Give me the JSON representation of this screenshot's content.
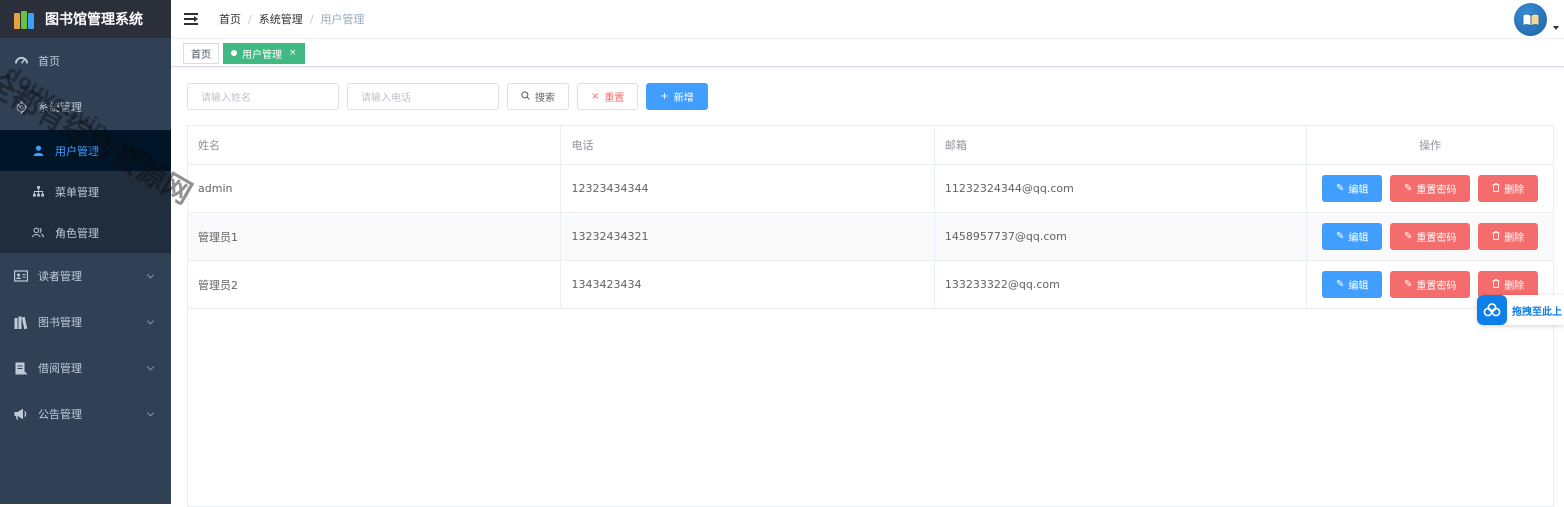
{
  "app": {
    "title": "图书馆管理系统"
  },
  "sidebar": {
    "items": [
      {
        "label": "首页",
        "icon": "dashboard-icon"
      },
      {
        "label": "系统管理",
        "icon": "gear-icon",
        "children": [
          {
            "label": "用户管理",
            "icon": "user-icon",
            "active": true
          },
          {
            "label": "菜单管理",
            "icon": "tree-icon"
          },
          {
            "label": "角色管理",
            "icon": "people-icon"
          }
        ]
      },
      {
        "label": "读者管理",
        "icon": "id-card-icon"
      },
      {
        "label": "图书管理",
        "icon": "books-icon"
      },
      {
        "label": "借阅管理",
        "icon": "document-icon"
      },
      {
        "label": "公告管理",
        "icon": "megaphone-icon"
      }
    ]
  },
  "breadcrumb": [
    "首页",
    "系统管理",
    "用户管理"
  ],
  "tags": [
    {
      "label": "首页",
      "active": false
    },
    {
      "label": "用户管理",
      "active": true,
      "close": "×"
    }
  ],
  "filters": {
    "name_placeholder": "请输入姓名",
    "phone_placeholder": "请输入电话",
    "search_label": "搜索",
    "reset_label": "重置",
    "add_label": "新增"
  },
  "table": {
    "headers": [
      "姓名",
      "电话",
      "邮箱",
      "操作"
    ],
    "rows": [
      {
        "name": "admin",
        "phone": "12323434344",
        "email": "11232324344@qq.com"
      },
      {
        "name": "管理员1",
        "phone": "13232434321",
        "email": "1458957737@qq.com"
      },
      {
        "name": "管理员2",
        "phone": "1343423434",
        "email": "133233322@qq.com"
      }
    ],
    "actions": {
      "edit": "编辑",
      "reset_password": "重置密码",
      "delete": "删除"
    }
  },
  "float_button": {
    "label": "拖拽至此上"
  },
  "watermark": {
    "line1": "全都有综合资源网",
    "line2": "douyouvip.com"
  },
  "colors": {
    "sidebar": "#304156",
    "primary": "#409eff",
    "danger": "#f56c6c",
    "tag_active": "#42b983"
  }
}
